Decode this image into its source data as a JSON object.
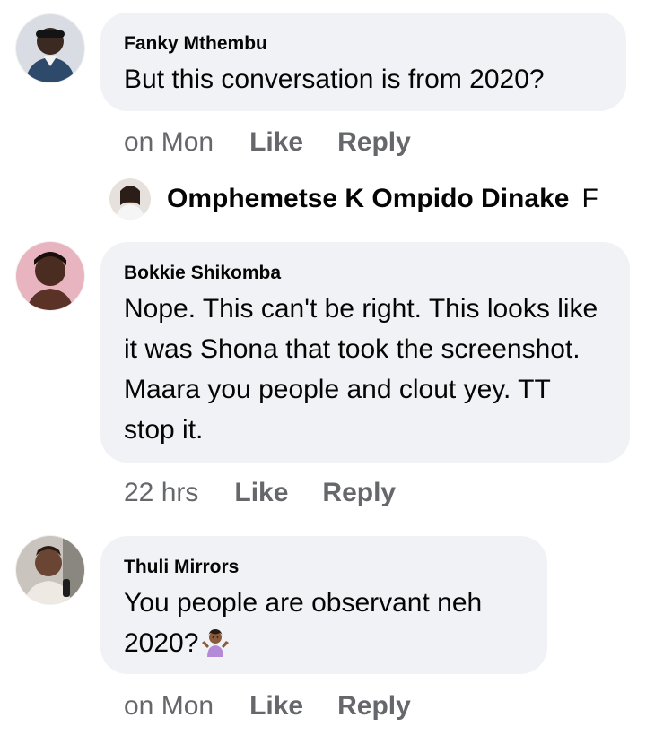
{
  "comments": [
    {
      "author": "Fanky Mthembu",
      "text": "But this conversation is from 2020?",
      "time": "on Mon",
      "like": "Like",
      "reply": "Reply"
    },
    {
      "author": "Bokkie Shikomba",
      "text": "Nope. This can't be right. This looks like it was Shona that took the screenshot. Maara you people and clout yey. TT stop it.",
      "time": "22 hrs",
      "like": "Like",
      "reply": "Reply"
    },
    {
      "author": "Thuli Mirrors",
      "text_line1": "You people are observant neh",
      "text_line2": "2020?",
      "emoji_icon": "person-shrugging-emoji",
      "time": "on Mon",
      "like": "Like",
      "reply": "Reply"
    }
  ],
  "reply_preview": {
    "author": "Omphemetse K Ompido Dinake",
    "snippet": "F"
  },
  "colors": {
    "bubble": "#f0f2f5",
    "text": "#050505",
    "meta": "#65676b"
  }
}
